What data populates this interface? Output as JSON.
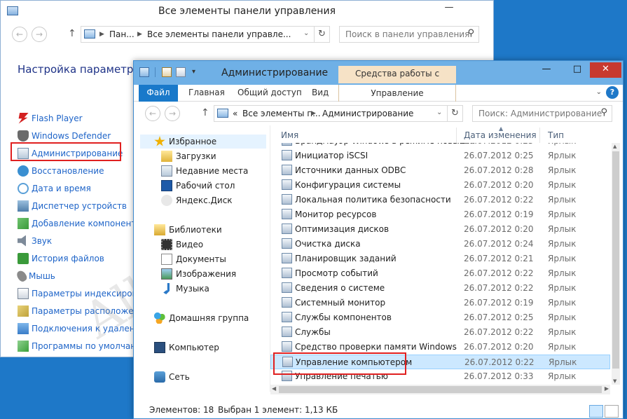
{
  "control_panel": {
    "title": "Все элементы панели управления",
    "minimize_glyph": "—",
    "breadcrumb": [
      "Пан...",
      "Все элементы панели управле..."
    ],
    "search_placeholder": "Поиск в панели управления",
    "heading": "Настройка параметров",
    "items": [
      {
        "label": "Flash Player",
        "icon": "flash-icon",
        "color": "#d32020"
      },
      {
        "label": "Windows Defender",
        "icon": "defender-icon",
        "color": "#6a6a6a"
      },
      {
        "label": "Администрирование",
        "icon": "admin-tools-icon",
        "color": "#6e8aa8"
      },
      {
        "label": "Восстановление",
        "icon": "recovery-icon",
        "color": "#3a8fd1"
      },
      {
        "label": "Дата и время",
        "icon": "clock-icon",
        "color": "#5aa0d8"
      },
      {
        "label": "Диспетчер устройств",
        "icon": "device-manager-icon",
        "color": "#4f7ea9"
      },
      {
        "label": "Добавление компонентов",
        "icon": "add-features-icon",
        "color": "#3b9a3b"
      },
      {
        "label": "Звук",
        "icon": "sound-icon",
        "color": "#7d8a99"
      },
      {
        "label": "История файлов",
        "icon": "file-history-icon",
        "color": "#3a9a3a"
      },
      {
        "label": "Мышь",
        "icon": "mouse-icon",
        "color": "#8a8a8a"
      },
      {
        "label": "Параметры индексирован",
        "icon": "indexing-icon",
        "color": "#7a8798"
      },
      {
        "label": "Параметры расположения",
        "icon": "location-icon",
        "color": "#bfa23a"
      },
      {
        "label": "Подключения к удаленны",
        "icon": "remote-icon",
        "color": "#3a7dc8"
      },
      {
        "label": "Программы по умолчани",
        "icon": "default-programs-icon",
        "color": "#3aa03a"
      }
    ]
  },
  "explorer": {
    "title": "Администрирование",
    "context_header": "Средства работы с ярлыками",
    "window_controls": {
      "minimize": "—",
      "maximize": "□",
      "close": "✕"
    },
    "ribbon_tabs": [
      "Файл",
      "Главная",
      "Общий доступ",
      "Вид"
    ],
    "context_tab": "Управление",
    "breadcrumb": [
      "«",
      "Все элементы п...",
      "Администрирование"
    ],
    "search_placeholder": "Поиск: Администрирование",
    "nav": {
      "favorites": "Избранное",
      "favorites_items": [
        "Загрузки",
        "Недавние места",
        "Рабочий стол",
        "Яндекс.Диск"
      ],
      "libraries": "Библиотеки",
      "libraries_items": [
        "Видео",
        "Документы",
        "Изображения",
        "Музыка"
      ],
      "homegroup": "Домашняя группа",
      "computer": "Компьютер",
      "network": "Сеть"
    },
    "columns": {
      "name": "Имя",
      "date": "Дата изменения",
      "type": "Тип"
    },
    "rows": [
      {
        "name": "Брандмауэр Windows в режиме повыш...",
        "date": "26.07.2012 0:25",
        "type": "Ярлык"
      },
      {
        "name": "Инициатор iSCSI",
        "date": "26.07.2012 0:25",
        "type": "Ярлык"
      },
      {
        "name": "Источники данных ODBC",
        "date": "26.07.2012 0:28",
        "type": "Ярлык"
      },
      {
        "name": "Конфигурация системы",
        "date": "26.07.2012 0:20",
        "type": "Ярлык"
      },
      {
        "name": "Локальная политика безопасности",
        "date": "26.07.2012 0:22",
        "type": "Ярлык"
      },
      {
        "name": "Монитор ресурсов",
        "date": "26.07.2012 0:19",
        "type": "Ярлык"
      },
      {
        "name": "Оптимизация дисков",
        "date": "26.07.2012 0:20",
        "type": "Ярлык"
      },
      {
        "name": "Очистка диска",
        "date": "26.07.2012 0:24",
        "type": "Ярлык"
      },
      {
        "name": "Планировщик заданий",
        "date": "26.07.2012 0:21",
        "type": "Ярлык"
      },
      {
        "name": "Просмотр событий",
        "date": "26.07.2012 0:22",
        "type": "Ярлык"
      },
      {
        "name": "Сведения о системе",
        "date": "26.07.2012 0:22",
        "type": "Ярлык"
      },
      {
        "name": "Системный монитор",
        "date": "26.07.2012 0:19",
        "type": "Ярлык"
      },
      {
        "name": "Службы компонентов",
        "date": "26.07.2012 0:25",
        "type": "Ярлык"
      },
      {
        "name": "Службы",
        "date": "26.07.2012 0:22",
        "type": "Ярлык"
      },
      {
        "name": "Средство проверки памяти Windows",
        "date": "26.07.2012 0:20",
        "type": "Ярлык"
      },
      {
        "name": "Управление компьютером",
        "date": "26.07.2012 0:22",
        "type": "Ярлык"
      },
      {
        "name": "Управление печатью",
        "date": "26.07.2012 0:33",
        "type": "Ярлык"
      }
    ],
    "selected_row": 15,
    "status": {
      "count": "Элементов: 18",
      "selected": "Выбран 1 элемент: 1,13 КБ"
    }
  },
  "watermark": "All4os.RU",
  "colors": {
    "accent": "#1979ca",
    "highlight": "#e02020",
    "selection": "#cce8ff"
  }
}
